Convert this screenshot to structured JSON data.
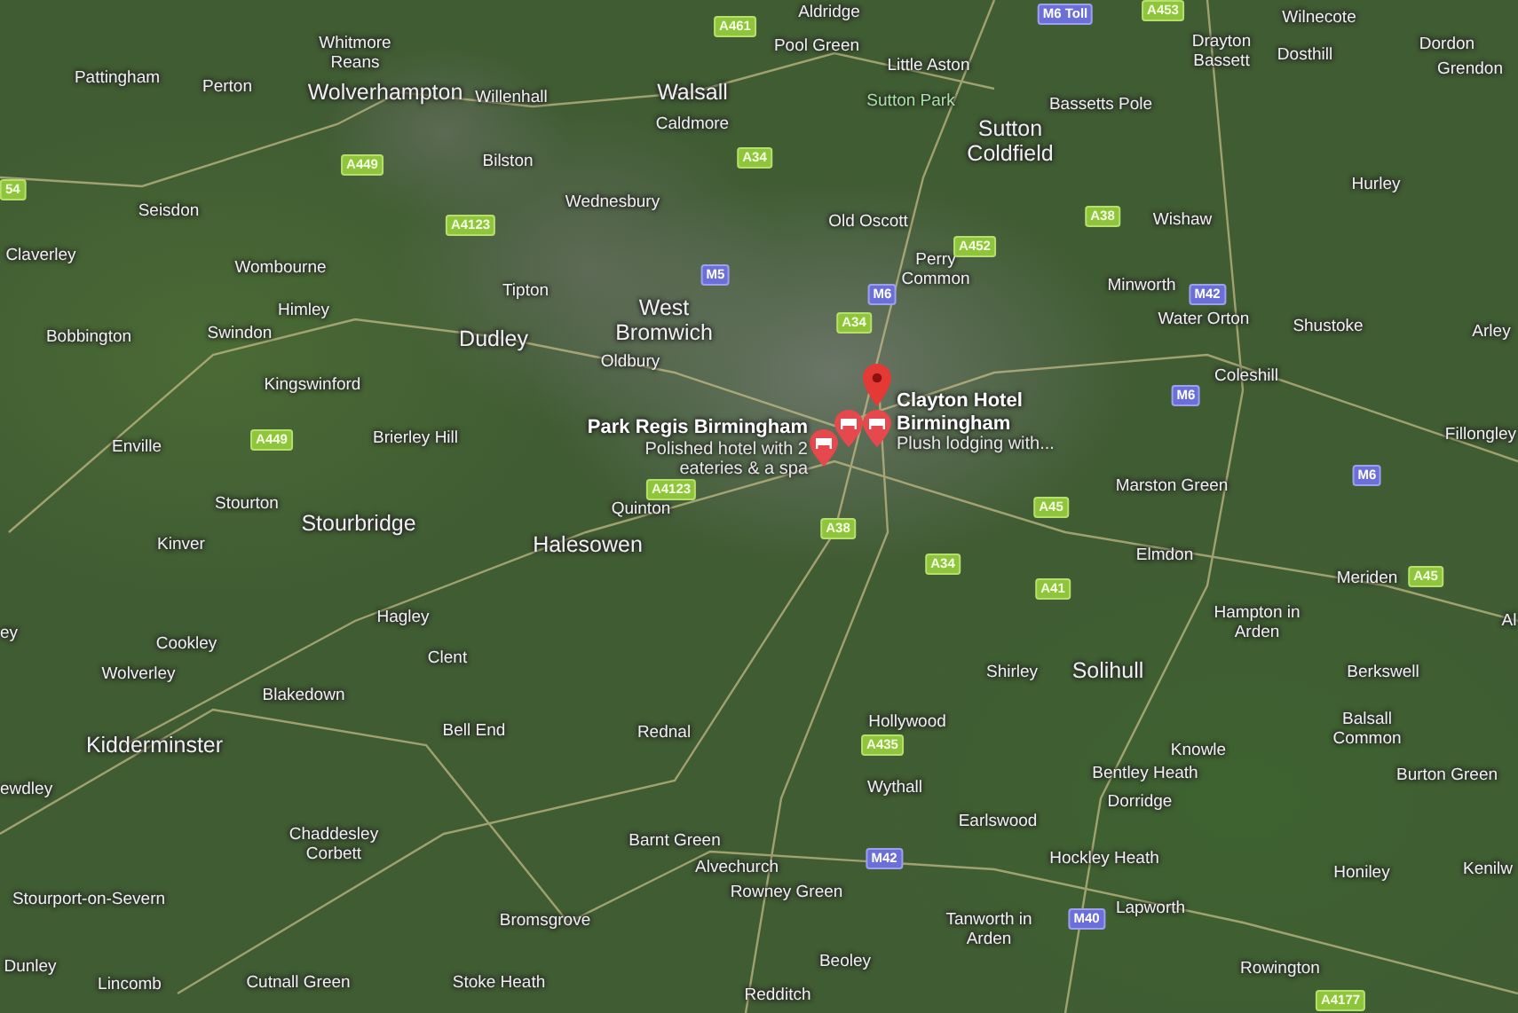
{
  "map": {
    "places": [
      {
        "name": "Aldridge",
        "kind": "town"
      },
      {
        "name": "Wilnecote",
        "kind": "town"
      },
      {
        "name": "Pattingham",
        "kind": "town"
      },
      {
        "name": "Perton",
        "kind": "town"
      },
      {
        "name": "Whitmore Reans",
        "kind": "town"
      },
      {
        "name": "Pool Green",
        "kind": "town"
      },
      {
        "name": "Little Aston",
        "kind": "town"
      },
      {
        "name": "Drayton Bassett",
        "kind": "town"
      },
      {
        "name": "Dosthill",
        "kind": "town"
      },
      {
        "name": "Dordon",
        "kind": "town"
      },
      {
        "name": "Grendon",
        "kind": "town"
      },
      {
        "name": "Wolverhampton",
        "kind": "city"
      },
      {
        "name": "Willenhall",
        "kind": "town"
      },
      {
        "name": "Walsall",
        "kind": "city"
      },
      {
        "name": "Sutton Park",
        "kind": "park"
      },
      {
        "name": "Bassetts Pole",
        "kind": "town"
      },
      {
        "name": "Caldmore",
        "kind": "town"
      },
      {
        "name": "Bilston",
        "kind": "town"
      },
      {
        "name": "Sutton Coldfield",
        "kind": "city"
      },
      {
        "name": "Seisdon",
        "kind": "town"
      },
      {
        "name": "Wednesbury",
        "kind": "town"
      },
      {
        "name": "Old Oscott",
        "kind": "town"
      },
      {
        "name": "Wishaw",
        "kind": "town"
      },
      {
        "name": "Hurley",
        "kind": "town"
      },
      {
        "name": "Claverley",
        "kind": "town"
      },
      {
        "name": "Wombourne",
        "kind": "town"
      },
      {
        "name": "Tipton",
        "kind": "town"
      },
      {
        "name": "Perry Common",
        "kind": "town"
      },
      {
        "name": "Minworth",
        "kind": "town"
      },
      {
        "name": "Bobbington",
        "kind": "town"
      },
      {
        "name": "Swindon",
        "kind": "town"
      },
      {
        "name": "Himley",
        "kind": "town"
      },
      {
        "name": "Dudley",
        "kind": "city"
      },
      {
        "name": "West Bromwich",
        "kind": "city"
      },
      {
        "name": "Water Orton",
        "kind": "town"
      },
      {
        "name": "Shustoke",
        "kind": "town"
      },
      {
        "name": "Arley",
        "kind": "town"
      },
      {
        "name": "Oldbury",
        "kind": "town"
      },
      {
        "name": "Kingswinford",
        "kind": "town"
      },
      {
        "name": "Coleshill",
        "kind": "town"
      },
      {
        "name": "Enville",
        "kind": "town"
      },
      {
        "name": "Brierley Hill",
        "kind": "town"
      },
      {
        "name": "Fillongley",
        "kind": "town"
      },
      {
        "name": "Marston Green",
        "kind": "town"
      },
      {
        "name": "Stourton",
        "kind": "town"
      },
      {
        "name": "Stourbridge",
        "kind": "city"
      },
      {
        "name": "Quinton",
        "kind": "town"
      },
      {
        "name": "Kinver",
        "kind": "town"
      },
      {
        "name": "Halesowen",
        "kind": "city"
      },
      {
        "name": "Elmdon",
        "kind": "town"
      },
      {
        "name": "Meriden",
        "kind": "town"
      },
      {
        "name": "ey",
        "kind": "town"
      },
      {
        "name": "Hagley",
        "kind": "town"
      },
      {
        "name": "Cookley",
        "kind": "town"
      },
      {
        "name": "Hampton in Arden",
        "kind": "town"
      },
      {
        "name": "Al",
        "kind": "town"
      },
      {
        "name": "Wolverley",
        "kind": "town"
      },
      {
        "name": "Clent",
        "kind": "town"
      },
      {
        "name": "Shirley",
        "kind": "town"
      },
      {
        "name": "Solihull",
        "kind": "city"
      },
      {
        "name": "Berkswell",
        "kind": "town"
      },
      {
        "name": "Blakedown",
        "kind": "town"
      },
      {
        "name": "Kidderminster",
        "kind": "city"
      },
      {
        "name": "Bell End",
        "kind": "town"
      },
      {
        "name": "Rednal",
        "kind": "town"
      },
      {
        "name": "Hollywood",
        "kind": "town"
      },
      {
        "name": "Knowle",
        "kind": "town"
      },
      {
        "name": "Balsall Common",
        "kind": "town"
      },
      {
        "name": "ewdley",
        "kind": "town"
      },
      {
        "name": "Wythall",
        "kind": "town"
      },
      {
        "name": "Bentley Heath",
        "kind": "town"
      },
      {
        "name": "Burton Green",
        "kind": "town"
      },
      {
        "name": "Earlswood",
        "kind": "town"
      },
      {
        "name": "Dorridge",
        "kind": "town"
      },
      {
        "name": "Chaddesley Corbett",
        "kind": "town"
      },
      {
        "name": "Barnt Green",
        "kind": "town"
      },
      {
        "name": "Alvechurch",
        "kind": "town"
      },
      {
        "name": "Hockley Heath",
        "kind": "town"
      },
      {
        "name": "Honiley",
        "kind": "town"
      },
      {
        "name": "Kenilw",
        "kind": "town"
      },
      {
        "name": "Stourport-on-Severn",
        "kind": "town"
      },
      {
        "name": "Rowney Green",
        "kind": "town"
      },
      {
        "name": "Bromsgrove",
        "kind": "town"
      },
      {
        "name": "Tanworth in Arden",
        "kind": "town"
      },
      {
        "name": "Lapworth",
        "kind": "town"
      },
      {
        "name": "Dunley",
        "kind": "town"
      },
      {
        "name": "Beoley",
        "kind": "town"
      },
      {
        "name": "Rowington",
        "kind": "town"
      },
      {
        "name": "Lincomb",
        "kind": "town"
      },
      {
        "name": "Cutnall Green",
        "kind": "town"
      },
      {
        "name": "Stoke Heath",
        "kind": "town"
      },
      {
        "name": "Redditch",
        "kind": "town"
      }
    ],
    "roads": [
      {
        "label": "A461",
        "kind": "a_road"
      },
      {
        "label": "M6 Toll",
        "kind": "motorway"
      },
      {
        "label": "A453",
        "kind": "a_road"
      },
      {
        "label": "54",
        "kind": "a_road"
      },
      {
        "label": "A449",
        "kind": "a_road"
      },
      {
        "label": "A4123",
        "kind": "a_road"
      },
      {
        "label": "A34",
        "kind": "a_road"
      },
      {
        "label": "M5",
        "kind": "motorway"
      },
      {
        "label": "A452",
        "kind": "a_road"
      },
      {
        "label": "M6",
        "kind": "motorway"
      },
      {
        "label": "A34",
        "kind": "a_road"
      },
      {
        "label": "A38",
        "kind": "a_road"
      },
      {
        "label": "M42",
        "kind": "motorway"
      },
      {
        "label": "M6",
        "kind": "motorway"
      },
      {
        "label": "M6",
        "kind": "motorway"
      },
      {
        "label": "A449",
        "kind": "a_road"
      },
      {
        "label": "A4123",
        "kind": "a_road"
      },
      {
        "label": "A38",
        "kind": "a_road"
      },
      {
        "label": "A34",
        "kind": "a_road"
      },
      {
        "label": "A45",
        "kind": "a_road"
      },
      {
        "label": "A41",
        "kind": "a_road"
      },
      {
        "label": "A45",
        "kind": "a_road"
      },
      {
        "label": "A435",
        "kind": "a_road"
      },
      {
        "label": "M42",
        "kind": "motorway"
      },
      {
        "label": "M40",
        "kind": "motorway"
      },
      {
        "label": "A4177",
        "kind": "a_road"
      }
    ],
    "pins": [
      {
        "kind": "location"
      },
      {
        "kind": "hotel"
      },
      {
        "kind": "hotel"
      },
      {
        "kind": "hotel"
      }
    ],
    "hotels": [
      {
        "name": "Park Regis Birmingham",
        "description": "Polished hotel with 2 eateries & a spa"
      },
      {
        "name": "Clayton Hotel Birmingham",
        "description": "Plush lodging with..."
      }
    ]
  }
}
